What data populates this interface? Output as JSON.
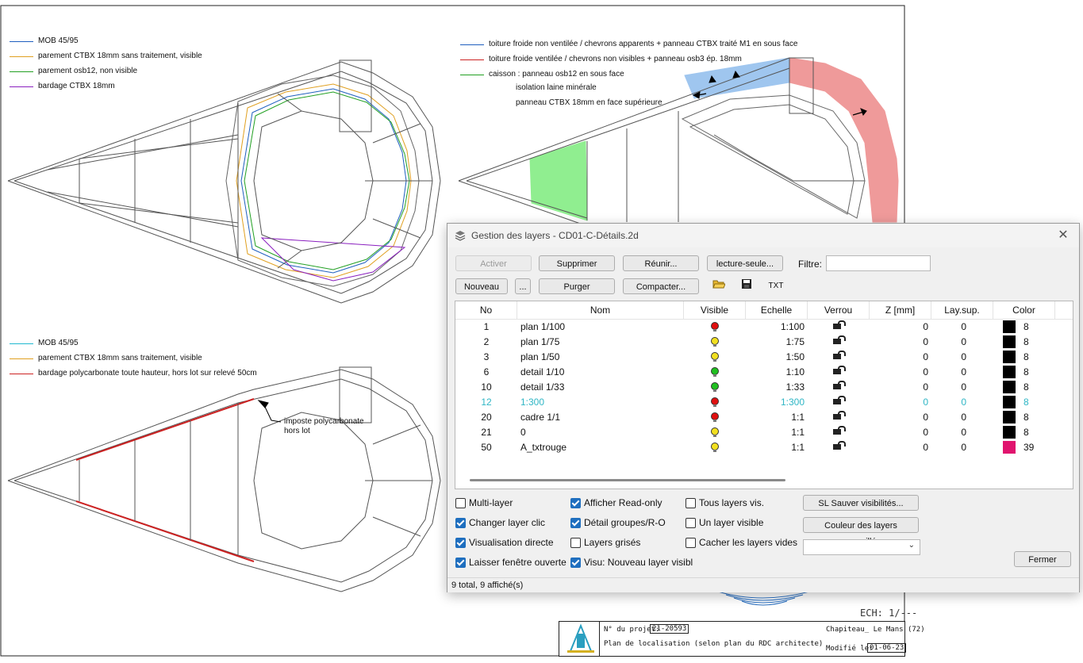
{
  "drawing": {
    "legend_top_left": [
      {
        "label": "MOB 45/95",
        "color": "#1f5fbf"
      },
      {
        "label": "parement CTBX 18mm sans traitement, visible",
        "color": "#e0a020"
      },
      {
        "label": "parement osb12, non visible",
        "color": "#22a022"
      },
      {
        "label": "bardage CTBX 18mm",
        "color": "#8a1fbf"
      }
    ],
    "legend_top_right": [
      {
        "label": "toiture froide non ventilée / chevrons apparents + panneau CTBX traité M1 en sous face",
        "color": "#1f5fbf"
      },
      {
        "label": "toiture froide ventilée / chevrons non visibles + panneau osb3 ép. 18mm",
        "color": "#cc2222"
      },
      {
        "label": "caisson : panneau osb12 en sous face",
        "color": "#22a022"
      }
    ],
    "legend_top_right_extra": [
      "isolation laine minérale",
      "panneau CTBX 18mm en face supérieure"
    ],
    "legend_bottom_left": [
      {
        "label": "MOB 45/95",
        "color": "#20b8d0"
      },
      {
        "label": "parement CTBX 18mm sans traitement, visible",
        "color": "#e0a020"
      },
      {
        "label": "bardage polycarbonate toute hauteur, hors lot sur relevé 50cm",
        "color": "#cc2222"
      }
    ],
    "annotation": "imposte polycarbonate\nhors lot",
    "colors": {
      "blue_zone": "#9fc6ef",
      "red_zone": "#ef9a9a",
      "green_zone": "#90ee90"
    }
  },
  "dialog": {
    "title": "Gestion des layers - CD01-C-Détails.2d",
    "buttons_row1": [
      "Activer",
      "Supprimer",
      "Réunir...",
      "lecture-seule..."
    ],
    "buttons_row2": [
      "Nouveau",
      "...",
      "Purger",
      "Compacter..."
    ],
    "txt_button": "TXT",
    "filter_label": "Filtre:",
    "filter_value": "",
    "columns": [
      "No",
      "Nom",
      "Visible",
      "Echelle",
      "Verrou",
      "Z [mm]",
      "Lay.sup.",
      "Color"
    ],
    "rows": [
      {
        "no": "1",
        "nom": "plan 1/100",
        "visible": "red",
        "echelle": "1:100",
        "z": "0",
        "laysup": "0",
        "color": "#000000",
        "colorno": "8"
      },
      {
        "no": "2",
        "nom": "plan 1/75",
        "visible": "yellow",
        "echelle": "1:75",
        "z": "0",
        "laysup": "0",
        "color": "#000000",
        "colorno": "8"
      },
      {
        "no": "3",
        "nom": "plan 1/50",
        "visible": "yellow",
        "echelle": "1:50",
        "z": "0",
        "laysup": "0",
        "color": "#000000",
        "colorno": "8"
      },
      {
        "no": "6",
        "nom": "detail 1/10",
        "visible": "green",
        "echelle": "1:10",
        "z": "0",
        "laysup": "0",
        "color": "#000000",
        "colorno": "8"
      },
      {
        "no": "10",
        "nom": "detail 1/33",
        "visible": "green",
        "echelle": "1:33",
        "z": "0",
        "laysup": "0",
        "color": "#000000",
        "colorno": "8"
      },
      {
        "no": "12",
        "nom": "1:300",
        "visible": "red",
        "echelle": "1:300",
        "z": "0",
        "laysup": "0",
        "color": "#000000",
        "colorno": "8",
        "active": true
      },
      {
        "no": "20",
        "nom": "cadre 1/1",
        "visible": "red",
        "echelle": "1:1",
        "z": "0",
        "laysup": "0",
        "color": "#000000",
        "colorno": "8"
      },
      {
        "no": "21",
        "nom": "0",
        "visible": "yellow",
        "echelle": "1:1",
        "z": "0",
        "laysup": "0",
        "color": "#000000",
        "colorno": "8"
      },
      {
        "no": "50",
        "nom": "A_txtrouge",
        "visible": "yellow",
        "echelle": "1:1",
        "z": "0",
        "laysup": "0",
        "color": "#e0146e",
        "colorno": "39"
      }
    ],
    "checkboxes": [
      {
        "label": "Multi-layer",
        "checked": false
      },
      {
        "label": "Changer layer clic",
        "checked": true
      },
      {
        "label": "Visualisation directe",
        "checked": true
      },
      {
        "label": "Laisser fenêtre ouverte",
        "checked": true
      },
      {
        "label": "Afficher Read-only",
        "checked": true
      },
      {
        "label": "Détail groupes/R-O",
        "checked": true
      },
      {
        "label": "Layers grisés",
        "checked": false
      },
      {
        "label": "Visu: Nouveau layer visibl",
        "checked": true
      },
      {
        "label": "Tous layers vis.",
        "checked": false
      },
      {
        "label": "Un layer visible",
        "checked": false
      },
      {
        "label": "Cacher les layers vides",
        "checked": false
      }
    ],
    "btn_save_vis": "SL Sauver visibilités...",
    "btn_lock_color": "Couleur des layers verrouillés",
    "select_value": "",
    "btn_close": "Fermer",
    "status": "9 total, 9 affiché(s)"
  },
  "titleblock": {
    "ech": "ECH: 1/---",
    "projet_label": "N° du projet:",
    "projet_value": "21-20593",
    "site": "Chapiteau_ Le Mans (72)",
    "description": "Plan de localisation (selon plan du RDC architecte)",
    "modifie_label": "Modifié le:",
    "modifie_value": "01-06-23"
  }
}
